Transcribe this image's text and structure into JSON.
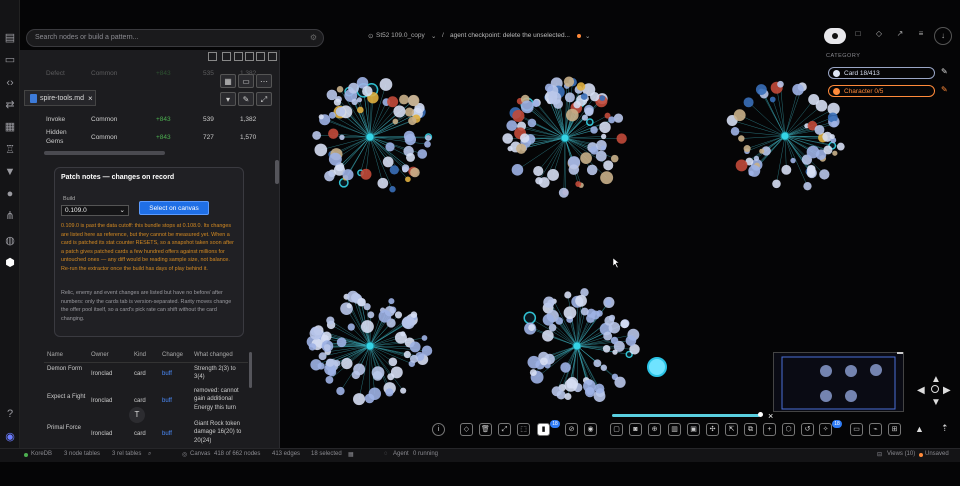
{
  "search": {
    "placeholder": "Search nodes or build a pattern..."
  },
  "header": {
    "left": "St52 109.0_copy",
    "sep": "/",
    "right": "agent checkpoint: delete the unselected..."
  },
  "file_tab": {
    "name": "spire-tools.md",
    "close": "×"
  },
  "table_top": {
    "rows": [
      {
        "c1": "Defect",
        "c2": "Common",
        "c3": "+843",
        "c4": "535",
        "c5": "1,382"
      },
      {
        "c1": "Invoke",
        "c2": "Common",
        "c3": "+843",
        "c4": "539",
        "c5": "1,382"
      },
      {
        "c1": "Hidden Gems",
        "c2": "Common",
        "c3": "+843",
        "c4": "727",
        "c5": "1,570"
      }
    ]
  },
  "patch_card": {
    "title": "Patch notes — changes on record",
    "build_label": "Build",
    "build_value": "0.109.0",
    "select_button": "Select on canvas",
    "warning": "0.109.0 is past the data cutoff: this bundle stops at 0.108.0. Its changes are listed here as reference, but they cannot be measured yet. When a card is patched its stat counter RESETS, so a snapshot taken soon after a patch gives patched cards a few hundred offers against millions for untouched ones — any diff would be reading sample size, not balance. Re-run the extractor once the build has days of play behind it.",
    "note": "Relic, enemy and event changes are listed but have no before/ after numbers: only the cards tab is version-separated. Rarity moves change the offer pool itself, so a card's pick rate can shift without the card changing."
  },
  "changes_table": {
    "headers": [
      "Name",
      "Owner",
      "Kind",
      "Change",
      "What changed"
    ],
    "rows": [
      {
        "name": "Demon Form",
        "owner": "Ironclad",
        "kind": "card",
        "change": "buff",
        "what": "Strength 2(3) to 3(4)"
      },
      {
        "name": "Expect a Fight",
        "owner": "Ironclad",
        "kind": "card",
        "change": "buff",
        "what": "removed: cannot gain additional Energy this turn"
      },
      {
        "name": "Primal Force",
        "owner": "Ironclad",
        "kind": "card",
        "change": "buff",
        "what": "Giant Rock token damage 16(20) to 20(24)"
      }
    ]
  },
  "category": {
    "heading": "CATEGORY",
    "items": [
      {
        "label": "Card 18/413",
        "color": "#cfd8f0"
      },
      {
        "label": "Character 0/5",
        "color": "#ff8a3a"
      }
    ]
  },
  "toolbar": {
    "badge1": "18",
    "badge2": "18",
    "close": "×"
  },
  "status": {
    "db": "KoreDB",
    "node_tables": "3 node tables",
    "rel_tables": "3 rel tables",
    "canvas": "Canvas",
    "nodes": "418 of 662 nodes",
    "edges": "413 edges",
    "selected": "18 selected",
    "agent": "Agent",
    "agent_state": "0 running",
    "views": "Views (10)",
    "unsaved": "Unsaved"
  }
}
